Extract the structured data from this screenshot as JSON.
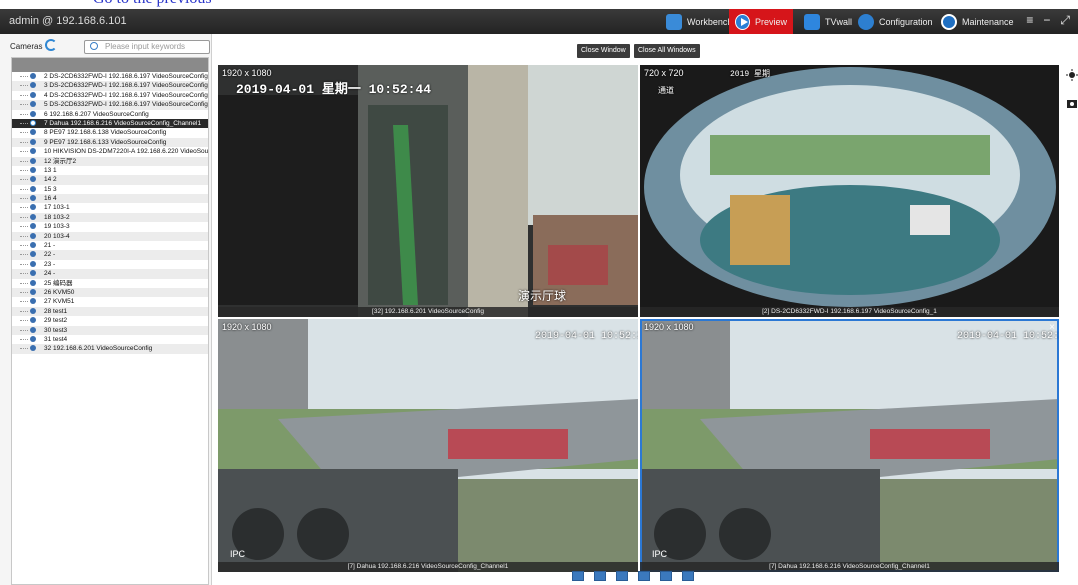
{
  "top_caption": "Go to the previous",
  "header": {
    "user": "admin @ 192.168.6.101",
    "nav": [
      {
        "label": "Workbench",
        "icon": "workbench-icon"
      },
      {
        "label": "Preview",
        "icon": "preview-icon",
        "active": true
      },
      {
        "label": "TVwall",
        "icon": "tvwall-icon"
      },
      {
        "label": "Configuration",
        "icon": "configuration-icon"
      },
      {
        "label": "Maintenance",
        "icon": "maintenance-icon"
      }
    ]
  },
  "sidebar": {
    "cameras_label": "Cameras",
    "search_placeholder": "Please input keywords",
    "items": [
      "2 DS-2CD6332FWD-I 192.168.6.197 VideoSourceConfig",
      "3 DS-2CD6332FWD-I 192.168.6.197 VideoSourceConfig",
      "4 DS-2CD6332FWD-I 192.168.6.197 VideoSourceConfig",
      "5 DS-2CD6332FWD-I 192.168.6.197 VideoSourceConfig",
      "6 192.168.6.207 VideoSourceConfig",
      "7 Dahua 192.168.6.216 VideoSourceConfig_Channel1",
      "8 PE97 192.168.6.138 VideoSourceConfig",
      "9 PE97 192.168.6.133 VideoSourceConfig",
      "10 HIKVISION DS-2DM7220I-A 192.168.6.220 VideoSourceConfig",
      "12 演示厅2",
      "13 1",
      "14 2",
      "15 3",
      "16 4",
      "17 103-1",
      "18 103-2",
      "19 103-3",
      "20 103-4",
      "21 -",
      "22 -",
      "23 -",
      "24 -",
      "25 编码器",
      "26 KVM50",
      "27 KVM51",
      "28 test1",
      "29 test2",
      "30 test3",
      "31 test4",
      "32 192.168.6.201 VideoSourceConfig"
    ],
    "selected_index": 5
  },
  "toolbar": {
    "close_window": "Close Window",
    "close_all": "Close All Windows"
  },
  "windows": [
    {
      "resolution": "1920 x 1080",
      "timestamp": "2019-04-01 星期一 10:52:44",
      "caption": "[32]  192.168.6.201 VideoSourceConfig",
      "overlay": "演示厅球"
    },
    {
      "resolution": "720 x 720",
      "timestamp": "2019 星期",
      "caption": "[2] DS-2CD6332FWD-I 192.168.6.197 VideoSourceConfig_1",
      "overlay": "通道"
    },
    {
      "resolution": "1920 x 1080",
      "timestamp": "2019-04-01 10:52:22",
      "caption": "[7] Dahua 192.168.6.216 VideoSourceConfig_Channel1",
      "overlay": "IPC"
    },
    {
      "resolution": "1920 x 1080",
      "timestamp": "2019-04-01 10:52:22",
      "caption": "[7] Dahua 192.168.6.216 VideoSourceConfig_Channel1",
      "overlay": "IPC",
      "close": "×"
    }
  ],
  "layout_icons": [
    "layout-4-icon",
    "layout-9-icon",
    "layout-16-icon",
    "layout-1-icon",
    "layout-6-icon",
    "layout-8-icon"
  ]
}
